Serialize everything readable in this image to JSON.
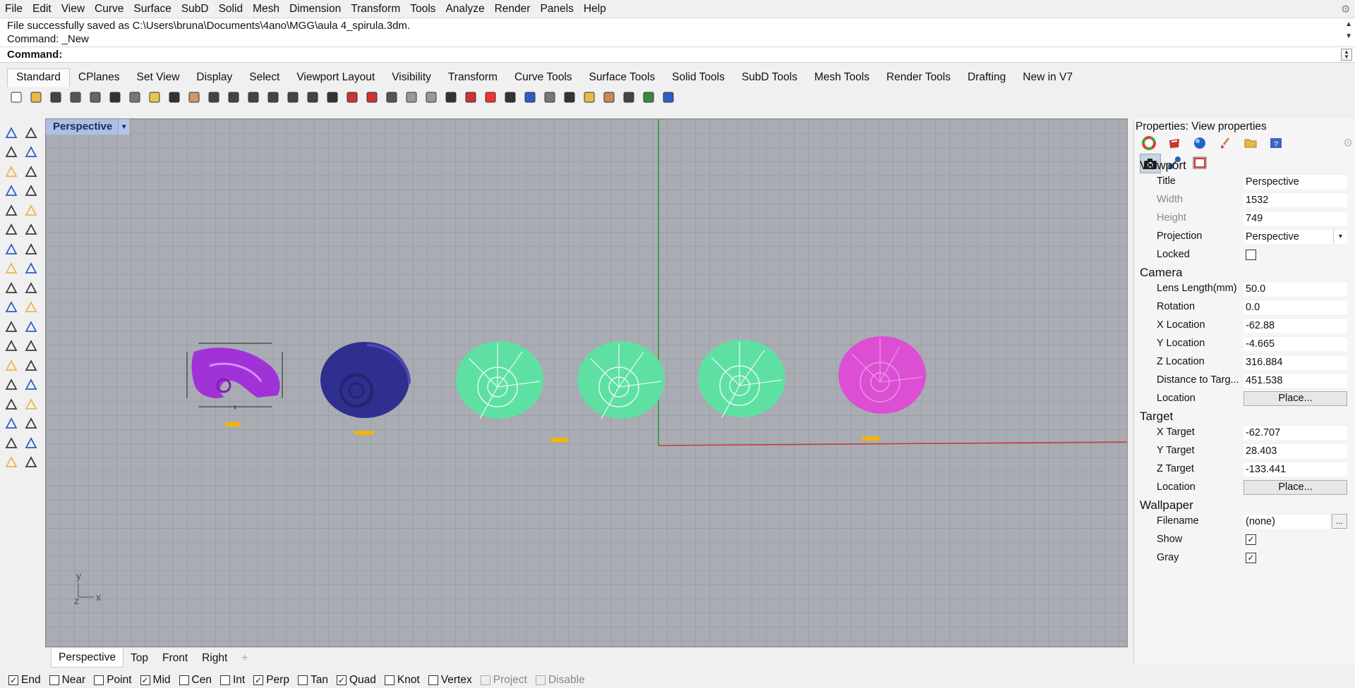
{
  "menu": [
    "File",
    "Edit",
    "View",
    "Curve",
    "Surface",
    "SubD",
    "Solid",
    "Mesh",
    "Dimension",
    "Transform",
    "Tools",
    "Analyze",
    "Render",
    "Panels",
    "Help"
  ],
  "command": {
    "history": [
      "File successfully saved as C:\\Users\\bruna\\Documents\\4ano\\MGG\\aula 4_spirula.3dm.",
      "Command: _New"
    ],
    "label": "Command:",
    "value": ""
  },
  "toolbar_tabs": [
    "Standard",
    "CPlanes",
    "Set View",
    "Display",
    "Select",
    "Viewport Layout",
    "Visibility",
    "Transform",
    "Curve Tools",
    "Surface Tools",
    "Solid Tools",
    "SubD Tools",
    "Mesh Tools",
    "Render Tools",
    "Drafting",
    "New in V7"
  ],
  "toolbar_icons": [
    "new-icon",
    "open-icon",
    "save-icon",
    "print-icon",
    "import-icon",
    "cut-icon",
    "copy-icon",
    "paste-icon",
    "undo-icon",
    "pan-icon",
    "move-view-icon",
    "zoom-icon",
    "zoom-window-icon",
    "zoom-extents-icon",
    "zoom-selected-icon",
    "rotate-view-icon",
    "grid-icon",
    "car-icon",
    "car-hidden-icon",
    "target-icon",
    "point-light-icon",
    "bulb-icon",
    "lock-icon",
    "layer-icon",
    "color-wheel-icon",
    "shade-icon",
    "render-sphere-icon",
    "material-icon",
    "render-icon",
    "filter-icon",
    "gear-cluster-icon",
    "dimension-icon",
    "globe-icon",
    "help-icon"
  ],
  "viewport": {
    "title": "Perspective",
    "axes": {
      "y": "y",
      "z": "z",
      "x": "x"
    },
    "objects": [
      {
        "name": "shell-purple",
        "color": "#a033d8"
      },
      {
        "name": "shell-navy",
        "color": "#2e2f8e"
      },
      {
        "name": "shell-green-1",
        "color": "#5fe0a3"
      },
      {
        "name": "shell-green-2",
        "color": "#5fe0a3"
      },
      {
        "name": "shell-green-3",
        "color": "#5fe0a3"
      },
      {
        "name": "shell-magenta",
        "color": "#dc4fd4"
      }
    ]
  },
  "view_tabs": [
    "Perspective",
    "Top",
    "Front",
    "Right"
  ],
  "osnaps": [
    {
      "label": "End",
      "checked": true,
      "disabled": false
    },
    {
      "label": "Near",
      "checked": false,
      "disabled": false
    },
    {
      "label": "Point",
      "checked": false,
      "disabled": false
    },
    {
      "label": "Mid",
      "checked": true,
      "disabled": false
    },
    {
      "label": "Cen",
      "checked": false,
      "disabled": false
    },
    {
      "label": "Int",
      "checked": false,
      "disabled": false
    },
    {
      "label": "Perp",
      "checked": true,
      "disabled": false
    },
    {
      "label": "Tan",
      "checked": false,
      "disabled": false
    },
    {
      "label": "Quad",
      "checked": true,
      "disabled": false
    },
    {
      "label": "Knot",
      "checked": false,
      "disabled": false
    },
    {
      "label": "Vertex",
      "checked": false,
      "disabled": false
    },
    {
      "label": "Project",
      "checked": false,
      "disabled": true
    },
    {
      "label": "Disable",
      "checked": false,
      "disabled": true
    }
  ],
  "properties": {
    "title": "Properties: View properties",
    "viewport_section": "Viewport",
    "title_label": "Title",
    "title_value": "Perspective",
    "width_label": "Width",
    "width_value": "1532",
    "height_label": "Height",
    "height_value": "749",
    "projection_label": "Projection",
    "projection_value": "Perspective",
    "locked_label": "Locked",
    "locked": false,
    "camera_section": "Camera",
    "lens_label": "Lens Length(mm)",
    "lens_value": "50.0",
    "rotation_label": "Rotation",
    "rotation_value": "0.0",
    "xloc_label": "X Location",
    "xloc_value": "-62.88",
    "yloc_label": "Y Location",
    "yloc_value": "-4.665",
    "zloc_label": "Z Location",
    "zloc_value": "316.884",
    "dist_label": "Distance to Targ...",
    "dist_value": "451.538",
    "cam_location_label": "Location",
    "place_label": "Place...",
    "target_section": "Target",
    "xtarget_label": "X Target",
    "xtarget_value": "-62.707",
    "ytarget_label": "Y Target",
    "ytarget_value": "28.403",
    "ztarget_label": "Z Target",
    "ztarget_value": "-133.441",
    "tgt_location_label": "Location",
    "wallpaper_section": "Wallpaper",
    "filename_label": "Filename",
    "filename_value": "(none)",
    "more_label": "...",
    "show_label": "Show",
    "show": true,
    "gray_label": "Gray",
    "gray": true
  }
}
